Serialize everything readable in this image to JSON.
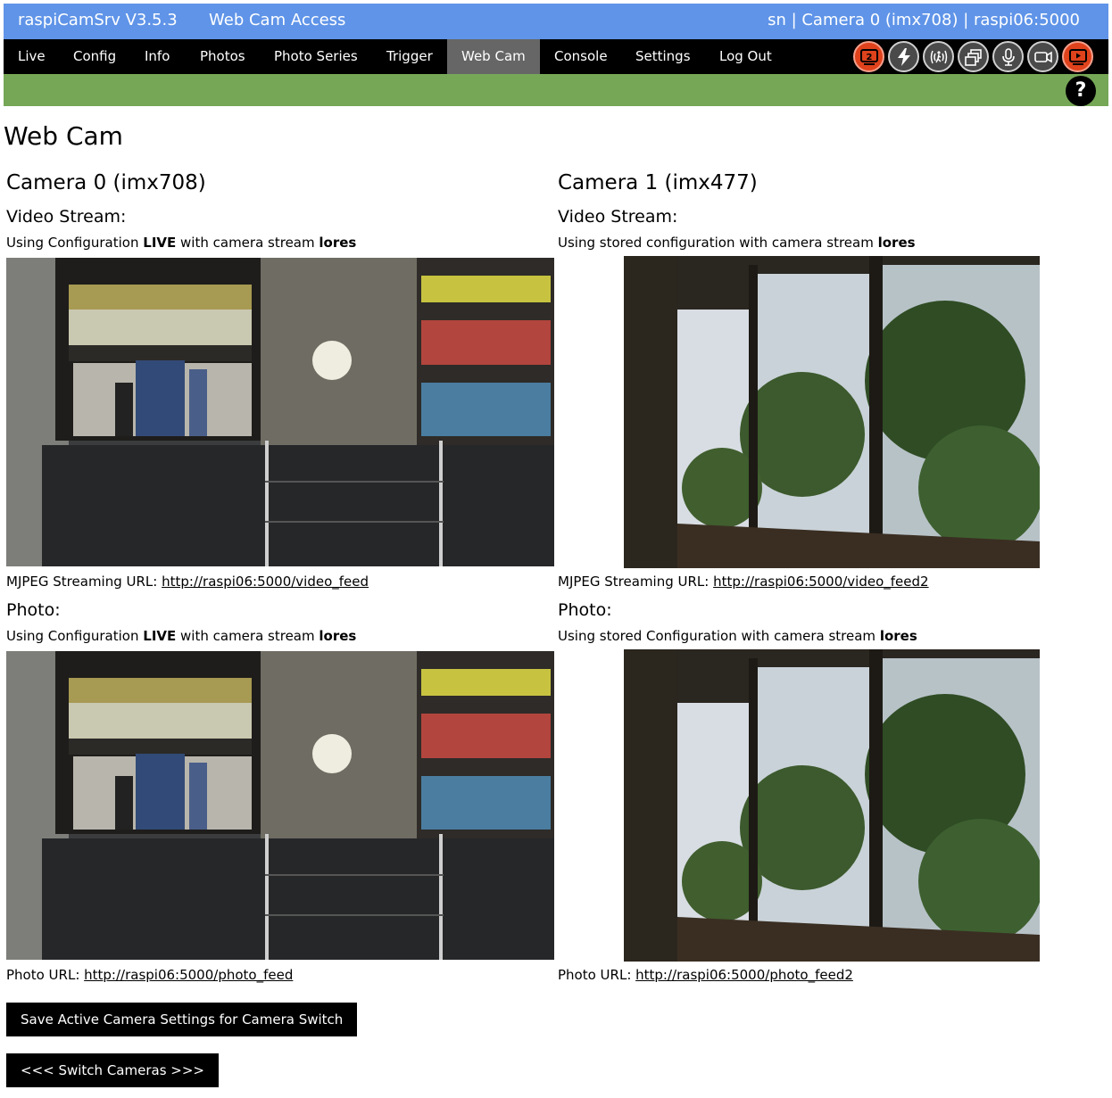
{
  "header": {
    "app_title": "raspiCamSrv V3.5.3",
    "page_title": "Web Cam Access",
    "status": "sn | Camera 0 (imx708) | raspi06:5000"
  },
  "nav": {
    "items": [
      {
        "label": "Live"
      },
      {
        "label": "Config"
      },
      {
        "label": "Info"
      },
      {
        "label": "Photos"
      },
      {
        "label": "Photo Series"
      },
      {
        "label": "Trigger"
      },
      {
        "label": "Web Cam"
      },
      {
        "label": "Console"
      },
      {
        "label": "Settings"
      },
      {
        "label": "Log Out"
      }
    ],
    "active": "Web Cam",
    "status_icons": [
      {
        "name": "camera-switch-icon",
        "label": "2",
        "color": "#e0421c"
      },
      {
        "name": "trigger-bolt-icon",
        "color": "#4a4a4a"
      },
      {
        "name": "motion-detection-icon",
        "color": "#4a4a4a"
      },
      {
        "name": "multi-window-icon",
        "color": "#4a4a4a"
      },
      {
        "name": "microphone-icon",
        "color": "#4a4a4a"
      },
      {
        "name": "video-camera-icon",
        "color": "#4a4a4a"
      },
      {
        "name": "live-stream-icon",
        "color": "#e0421c"
      }
    ],
    "help_label": "?"
  },
  "colors": {
    "title_bar": "#5f94e8",
    "nav_bar": "#000000",
    "active_tab": "#666666",
    "green_bar": "#76a757",
    "alert_icon": "#e0421c"
  },
  "page": {
    "title": "Web Cam"
  },
  "cameras": [
    {
      "heading": "Camera 0 (imx708)",
      "video_label": "Video Stream:",
      "video_cfg_pre": "Using Configuration ",
      "video_cfg_bold": "LIVE",
      "video_cfg_mid": " with camera stream ",
      "video_cfg_stream": "lores",
      "mjpeg_label": "MJPEG Streaming URL: ",
      "mjpeg_url": "http://raspi06:5000/video_feed",
      "photo_label": "Photo:",
      "photo_cfg_pre": "Using Configuration ",
      "photo_cfg_bold": "LIVE",
      "photo_cfg_mid": " with camera stream ",
      "photo_cfg_stream": "lores",
      "photo_url_label": "Photo URL: ",
      "photo_url": "http://raspi06:5000/photo_feed"
    },
    {
      "heading": "Camera 1 (imx477)",
      "video_label": "Video Stream:",
      "video_cfg_pre": "Using stored configuration with camera stream ",
      "video_cfg_stream": "lores",
      "mjpeg_label": "MJPEG Streaming URL: ",
      "mjpeg_url": "http://raspi06:5000/video_feed2",
      "photo_label": "Photo:",
      "photo_cfg_pre": "Using stored Configuration with camera stream ",
      "photo_cfg_stream": "lores",
      "photo_url_label": "Photo URL: ",
      "photo_url": "http://raspi06:5000/photo_feed2"
    }
  ],
  "buttons": {
    "save_settings": "Save Active Camera Settings for Camera Switch",
    "switch_cameras": "<<< Switch Cameras >>>"
  }
}
